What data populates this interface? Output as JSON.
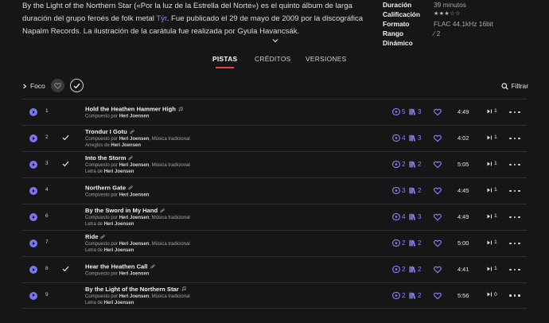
{
  "description": {
    "before_link": "By the Light of the Northern Star («Por la luz de la Estrella del Norte») es el quinto álbum de larga duración del grupo feroés de folk metal ",
    "link": "Týr",
    "after_link": ". Fue publicado el 29 de mayo de 2009 por la discográfica Napalm Records. La ilustración de la carátula fue realizada por Gyula Havancsák."
  },
  "meta": [
    {
      "key": "Duración",
      "value": "39 minutos"
    },
    {
      "key": "Calificación",
      "value": "★★★☆☆"
    },
    {
      "key": "Formato",
      "value": "FLAC 44.1kHz 16bit"
    },
    {
      "key": "Rango Dinámico",
      "value": "⁄ 2"
    }
  ],
  "tabs": [
    "PISTAS",
    "CRÉDITOS",
    "VERSIONES"
  ],
  "toolbar": {
    "focus_label": "Foco",
    "filter_label": "Filtrar"
  },
  "colors": {
    "accent": "#7b74ef",
    "tab_underline": "#e4453c"
  },
  "tracks": [
    {
      "num": "1",
      "checked": false,
      "title": "Hold the Heathen Hammer High",
      "title_icon": "music-note-icon",
      "lines": [
        [
          "Compuesto por ",
          "Heri Joensen",
          ""
        ]
      ],
      "versions": "5",
      "credits": "3",
      "duration": "4:49",
      "plays": "1"
    },
    {
      "num": "2",
      "checked": true,
      "title": "Trondur I Gotu",
      "title_icon": "link-icon",
      "lines": [
        [
          "Compuesto por ",
          "Heri Joensen",
          ", Música tradicional"
        ],
        [
          "Arreglos de ",
          "Heri Joensen",
          ""
        ]
      ],
      "versions": "4",
      "credits": "3",
      "duration": "4:02",
      "plays": "1"
    },
    {
      "num": "3",
      "checked": true,
      "title": "Into the Storm",
      "title_icon": "link-icon",
      "lines": [
        [
          "Compuesto por ",
          "Heri Joensen",
          ", Música tradicional"
        ],
        [
          "Letra de ",
          "Heri Joensen",
          ""
        ]
      ],
      "versions": "2",
      "credits": "2",
      "duration": "5:05",
      "plays": "1"
    },
    {
      "num": "4",
      "checked": false,
      "title": "Northern Gate",
      "title_icon": "link-icon",
      "lines": [
        [
          "Compuesto por ",
          "Heri Joensen",
          ""
        ]
      ],
      "versions": "3",
      "credits": "2",
      "duration": "4:45",
      "plays": "1"
    },
    {
      "num": "6",
      "checked": false,
      "title": "By the Sword in My Hand",
      "title_icon": "link-icon",
      "lines": [
        [
          "Compuesto por ",
          "Heri Joensen",
          ", Música tradicional"
        ],
        [
          "Letra de ",
          "Heri Joensen",
          ""
        ]
      ],
      "versions": "4",
      "credits": "3",
      "duration": "4:49",
      "plays": "1"
    },
    {
      "num": "7",
      "checked": false,
      "title": "Ride",
      "title_icon": "link-icon",
      "lines": [
        [
          "Compuesto por ",
          "Heri Joensen",
          ", Música tradicional"
        ],
        [
          "Letra de ",
          "Heri Joensen",
          ""
        ]
      ],
      "versions": "2",
      "credits": "2",
      "duration": "5:00",
      "plays": "1"
    },
    {
      "num": "8",
      "checked": true,
      "title": "Hear the Heathen Call",
      "title_icon": "link-icon",
      "lines": [
        [
          "Compuesto por ",
          "Heri Joensen",
          ""
        ]
      ],
      "versions": "2",
      "credits": "2",
      "duration": "4:41",
      "plays": "1"
    },
    {
      "num": "9",
      "checked": false,
      "title": "By the Light of the Northern Star",
      "title_icon": "music-note-icon",
      "lines": [
        [
          "Compuesto por ",
          "Heri Joensen",
          ", Música tradicional"
        ],
        [
          "Letra de ",
          "Heri Joensen",
          ""
        ]
      ],
      "versions": "2",
      "credits": "2",
      "duration": "5:56",
      "plays": "0"
    }
  ]
}
